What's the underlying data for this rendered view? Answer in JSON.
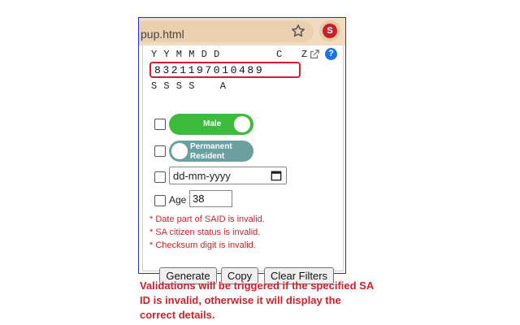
{
  "browser": {
    "url_fragment": "pup.html",
    "extension_badge": "S"
  },
  "id_panel": {
    "top_labels": "Y Y M M D D         C   Z",
    "id_value": "8321197010489",
    "bottom_labels": "S S S S    A",
    "help_symbol": "?"
  },
  "filters": {
    "gender_label": "Male",
    "residency_label": "Permanent Resident",
    "date_placeholder": "dd-mm-yyyy",
    "age_label": "Age",
    "age_value": "38"
  },
  "errors": [
    "* Date part of SAID is invalid.",
    "* SA citizen status is invalid.",
    "* Checksum digit is invalid."
  ],
  "buttons": {
    "generate": "Generate",
    "copy": "Copy",
    "clear_filters": "Clear Filters"
  },
  "caption": "Validations will be triggered if the specified SA ID is invalid, otherwise it will display the correct details.",
  "colors": {
    "error_red": "#d21f2a",
    "toggle_on_green": "#3dbb3d",
    "toggle_off_teal": "#6b9fa0",
    "frame_blue": "#2b2bd6"
  }
}
